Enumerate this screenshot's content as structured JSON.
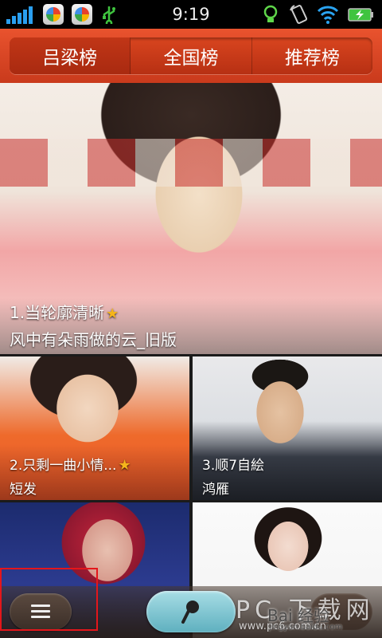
{
  "status_bar": {
    "time": "9:19",
    "signal_color": "#2a9ff0",
    "icons": [
      "signal-icon",
      "app-icon",
      "app-icon",
      "usb-icon",
      "lightbulb-icon",
      "rotate-lock-icon",
      "wifi-icon",
      "battery-charging-icon"
    ]
  },
  "tabs": [
    {
      "label": "吕梁榜",
      "active": true
    },
    {
      "label": "全国榜",
      "active": false
    },
    {
      "label": "推荐榜",
      "active": false
    }
  ],
  "accent": "#d9451f",
  "tiles": [
    {
      "rank_title": "1.当轮廓清晰",
      "starred": true,
      "subtitle": "风中有朵雨做的云_旧版"
    },
    {
      "rank_title": "2.只剩一曲小情...",
      "starred": true,
      "subtitle": "短发"
    },
    {
      "rank_title": "3.顺7自絵",
      "starred": false,
      "subtitle": "鸿雁"
    }
  ],
  "watermarks": {
    "site_cn": "PC 下载网",
    "site_url": "www.pc6.com.cn",
    "baidu": "Bai 经验",
    "baidu_url": "jingyan.baidu.com"
  }
}
